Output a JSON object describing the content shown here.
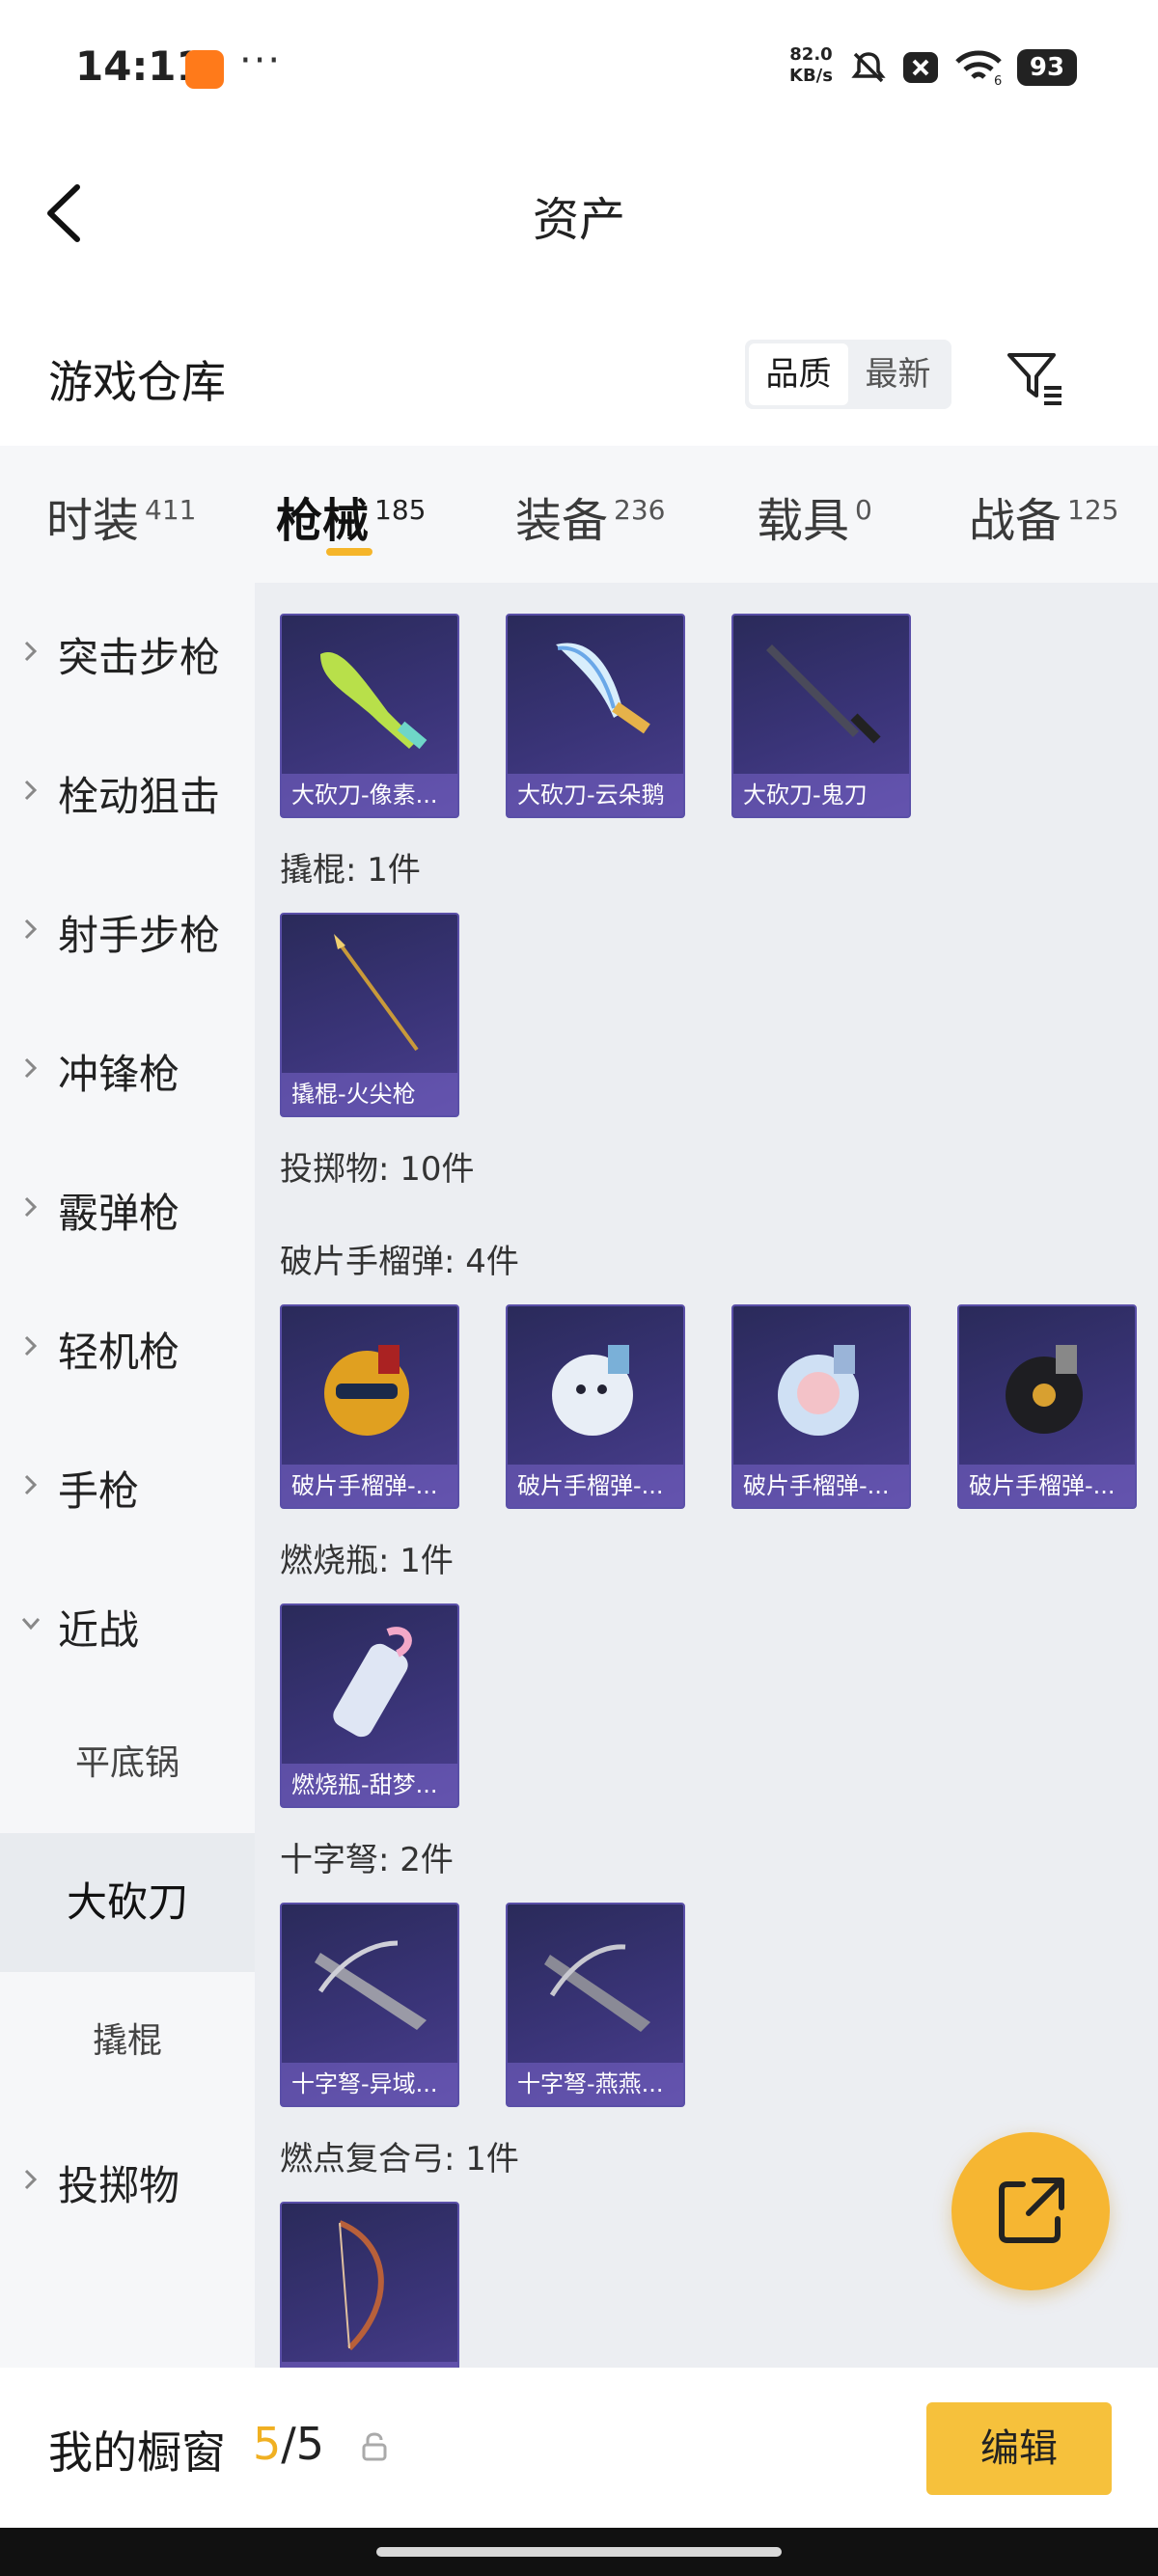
{
  "status_bar": {
    "time": "14:11",
    "more": "···",
    "net_speed_value": "82.0",
    "net_speed_unit": "KB/s",
    "wifi_badge": "6",
    "battery": "93"
  },
  "header": {
    "title": "资产"
  },
  "warehouse": {
    "title": "游戏仓库",
    "sort_options": [
      "品质",
      "最新"
    ],
    "sort_active": "品质"
  },
  "tabs": [
    {
      "label": "时装",
      "count": "411"
    },
    {
      "label": "枪械",
      "count": "185",
      "active": true
    },
    {
      "label": "装备",
      "count": "236"
    },
    {
      "label": "载具",
      "count": "0"
    },
    {
      "label": "战备",
      "count": "125"
    }
  ],
  "sidebar": {
    "items": [
      {
        "label": "突击步枪"
      },
      {
        "label": "栓动狙击"
      },
      {
        "label": "射手步枪"
      },
      {
        "label": "冲锋枪"
      },
      {
        "label": "霰弹枪"
      },
      {
        "label": "轻机枪"
      },
      {
        "label": "手枪"
      },
      {
        "label": "近战",
        "expanded": true
      }
    ],
    "sub_items": [
      {
        "label": "平底锅"
      },
      {
        "label": "大砍刀",
        "active": true
      },
      {
        "label": "撬棍"
      }
    ],
    "after": {
      "label": "投掷物"
    }
  },
  "content": {
    "sections": [
      {
        "label": "",
        "items": [
          "大砍刀-像素...",
          "大砍刀-云朵鹅",
          "大砍刀-鬼刀"
        ]
      },
      {
        "label": "撬棍: 1件",
        "items": [
          "撬棍-火尖枪"
        ]
      },
      {
        "label": "投掷物: 10件",
        "items": []
      },
      {
        "label": "破片手榴弹: 4件",
        "items": [
          "破片手榴弹-...",
          "破片手榴弹-...",
          "破片手榴弹-...",
          "破片手榴弹-..."
        ]
      },
      {
        "label": "燃烧瓶: 1件",
        "items": [
          "燃烧瓶-甜梦..."
        ]
      },
      {
        "label": "十字弩: 2件",
        "items": [
          "十字弩-异域...",
          "十字弩-燕燕..."
        ]
      },
      {
        "label": "燃点复合弓: 1件",
        "items": [
          ""
        ]
      }
    ]
  },
  "bottom_bar": {
    "showcase_label": "我的橱窗",
    "showcase_used": "5",
    "showcase_sep_total": "/5",
    "edit_label": "编辑"
  },
  "colors": {
    "accent": "#f6c13c",
    "card_bg": "#3a3478"
  }
}
